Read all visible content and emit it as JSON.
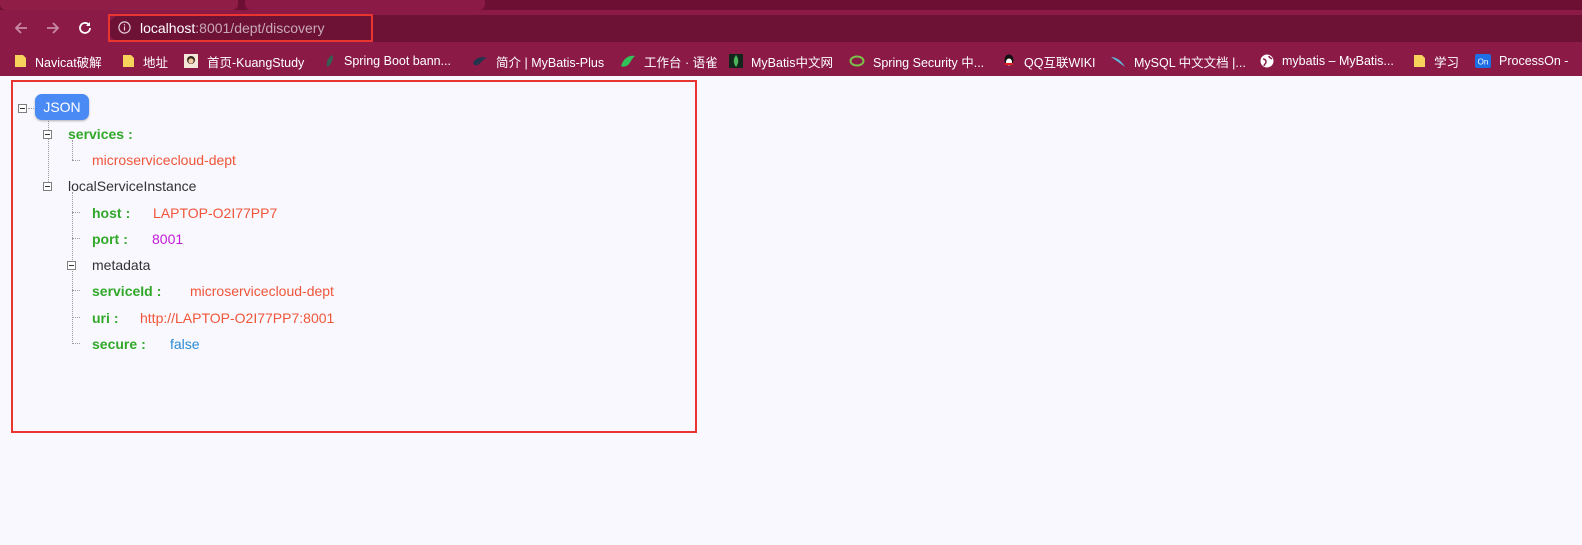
{
  "browser": {
    "address": {
      "host": "localhost",
      "rest": ":8001/dept/discovery"
    },
    "bookmarks": [
      {
        "label": "Navicat破解",
        "icon": "folder-icon"
      },
      {
        "label": "地址",
        "icon": "folder-icon"
      },
      {
        "label": "首页-KuangStudy",
        "icon": "avatar-icon"
      },
      {
        "label": "Spring Boot bann...",
        "icon": "leaf-icon"
      },
      {
        "label": "简介 | MyBatis-Plus",
        "icon": "bird-icon"
      },
      {
        "label": "工作台 · 语雀",
        "icon": "yuque-icon"
      },
      {
        "label": "MyBatis中文网",
        "icon": "leaf-icon"
      },
      {
        "label": "Spring Security 中...",
        "icon": "spring-icon"
      },
      {
        "label": "QQ互联WIKI",
        "icon": "qq-icon"
      },
      {
        "label": "MySQL 中文文档 |...",
        "icon": "mysql-icon"
      },
      {
        "label": "mybatis – MyBatis...",
        "icon": "globe-icon"
      },
      {
        "label": "学习",
        "icon": "folder-icon"
      },
      {
        "label": "ProcessOn -",
        "icon": "processon-icon"
      }
    ]
  },
  "json_view": {
    "root_label": "JSON",
    "services_key": "services",
    "services_value": "microservicecloud-dept",
    "instance_label": "localServiceInstance",
    "host_key": "host",
    "host_value": "LAPTOP-O2I77PP7",
    "port_key": "port",
    "port_value": "8001",
    "metadata_label": "metadata",
    "serviceId_key": "serviceId",
    "serviceId_value": "microservicecloud-dept",
    "uri_key": "uri",
    "uri_value": "http://LAPTOP-O2I77PP7:8001",
    "secure_key": "secure",
    "secure_value": "false",
    "colon": ":"
  },
  "colors": {
    "chrome": "#8b1a47",
    "highlight": "#e8352f",
    "key": "#31a82a",
    "string": "#f0553a",
    "number": "#c41ad8",
    "boolean": "#2a8ad4"
  }
}
